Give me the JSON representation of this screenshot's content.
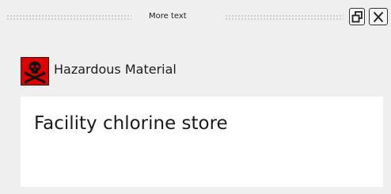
{
  "window": {
    "title": "More text",
    "restore_button": "restore-icon",
    "close_button": "close-icon"
  },
  "header": {
    "icon": "skull-crossbones-icon",
    "icon_bg_color": "#e00000",
    "label": "Hazardous Material"
  },
  "content": {
    "text": "Facility chlorine store"
  }
}
